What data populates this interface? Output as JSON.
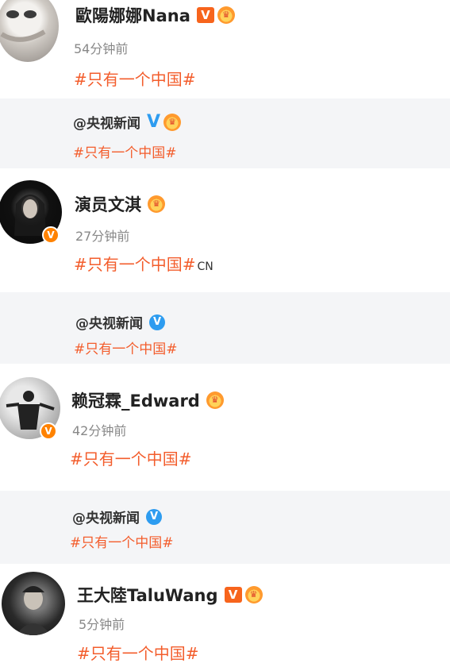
{
  "posts": [
    {
      "name": "歐陽娜娜Nana",
      "time": "54分钟前",
      "topic": "#只有一个中国#",
      "topic_suffix": ""
    },
    {
      "name": "演员文淇",
      "time": "27分钟前",
      "topic": "#只有一个中国#",
      "topic_suffix": "CN"
    },
    {
      "name": "赖冠霖_Edward",
      "time": "42分钟前",
      "topic": "#只有一个中国#",
      "topic_suffix": ""
    },
    {
      "name": "王大陸TaluWang",
      "time": "5分钟前",
      "topic": "#只有一个中国#",
      "topic_suffix": ""
    }
  ],
  "quotes": [
    {
      "name": "@央视新闻",
      "topic": "#只有一个中国#"
    },
    {
      "name": "@央视新闻",
      "topic": "#只有一个中国#"
    },
    {
      "name": "@央视新闻",
      "topic": "#只有一个中国#"
    }
  ],
  "badges": {
    "verified_letter": "V",
    "crown_glyph": "♛"
  },
  "colors": {
    "topic": "#f35d2c",
    "verified_orange": "#f7641c",
    "verified_blue": "#2d9cf0",
    "quote_background": "#f4f5f7"
  }
}
